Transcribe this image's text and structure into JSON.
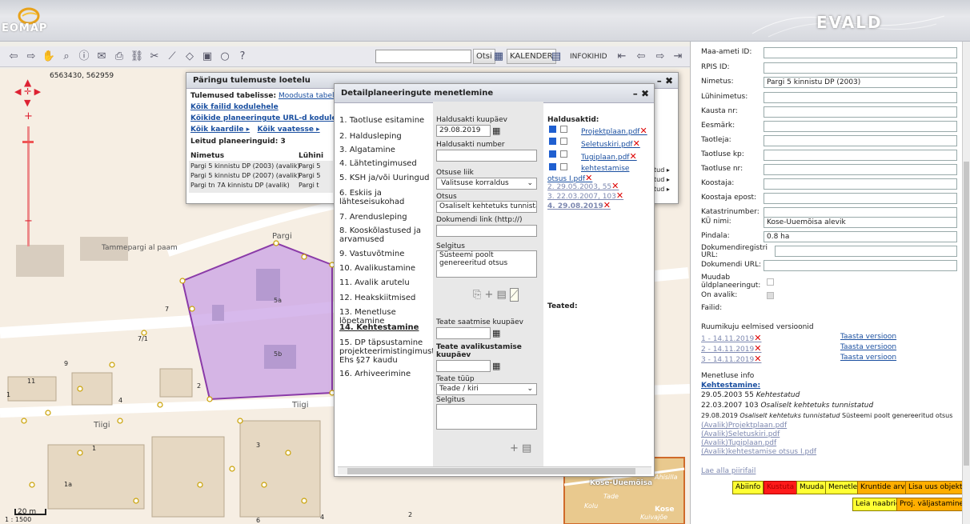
{
  "header": {
    "logo_text": "EOMAP",
    "brand": "EVALD"
  },
  "toolbar": {
    "search_button": "Otsi",
    "calendar_label": "KALENDER",
    "info_label": "INFOKIHID"
  },
  "map": {
    "coords": "6563430, 562959",
    "scale_bar": "20 m",
    "scale": "1 : 1500",
    "labels": {
      "tamme": "Tammepargi al paam",
      "pargi": "Pargi",
      "tiigi1": "Tiigi",
      "tiigi2": "Tiigi",
      "kose": "Kose-Uuemõisa",
      "tade": "Tade",
      "kolu": "Kolu",
      "kose2": "Kose",
      "ahisilla": "Ahisilla",
      "kuivajoe": "Kuivajõe"
    },
    "parcels": [
      "5a",
      "5b",
      "7",
      "7/1",
      "9",
      "11",
      "1",
      "4",
      "2",
      "1a",
      "3",
      "1",
      "2",
      "6",
      "4"
    ]
  },
  "results_window": {
    "title": "Päringu tulemuste loetelu",
    "tabular_label": "Tulemused tabelisse:",
    "tabular_link": "Moodusta tabel/välj",
    "links": [
      "Kõik failid kodulehele",
      "Kõikide planeeringute URL-d kodulehele"
    ],
    "all_map": "Kõik kaardile ▸",
    "all_view": "Kõik vaatesse ▸",
    "found": "Leitud planeeringuid: 3",
    "col_name": "Nimetus",
    "col_short": "Lühini",
    "rows": [
      {
        "name": "Pargi 5 kinnistu DP (2003) (avalik)",
        "short": "Pargi 5",
        "tail": "tud ▸"
      },
      {
        "name": "Pargi 5 kinnistu DP (2007) (avalik)",
        "short": "Pargi 5",
        "tail": "tud ▸"
      },
      {
        "name": "Pargi tn 7A kinnistu DP (avalik)",
        "short": "Pargi t",
        "tail": "tud ▸"
      }
    ]
  },
  "proc_window": {
    "title": "Detailplaneeringute menetlemine",
    "steps": [
      "1. Taotluse esitamine",
      "2. Haldusleping",
      "3. Algatamine",
      "4. Lähtetingimused",
      "5. KSH ja/või Uuringud",
      "6. Eskiis ja lähteseisukohad",
      "7. Arendusleping",
      "8. Kooskõlastused ja arvamused",
      "9. Vastuvõtmine",
      "10. Avalikustamine",
      "11. Avalik arutelu",
      "12. Heakskiitmised",
      "13. Menetluse lõpetamine",
      "14. Kehtestamine",
      "15. DP täpsustamine projekteerimistingimuste Ehs §27 kaudu",
      "16. Arhiveerimine"
    ],
    "haldusakti_kp_label": "Haldusakti kuupäev",
    "haldusakti_kp": "29.08.2019",
    "haldusakti_nr_label": "Haldusakti number",
    "haldusakti_nr": "",
    "otsuse_liik_label": "Otsuse liik",
    "otsuse_liik": "Valitsuse korraldus",
    "otsus_label": "Otsus",
    "otsus": "Osaliselt kehtetuks tunnista",
    "dok_link_label": "Dokumendi link (http://)",
    "dok_link": "",
    "selgitus_label": "Selgitus",
    "selgitus": "Süsteemi poolt genereeritud otsus",
    "haldusaktid_label": "Haldusaktid:",
    "files": [
      "Projektplaan.pdf",
      "Seletuskiri.pdf",
      "Tugiplaan.pdf",
      "kehtestamise otsus I.pdf"
    ],
    "acts": [
      "2. 29.05.2003, 55",
      "3. 22.03.2007, 103",
      "4. 29.08.2019"
    ],
    "teated_label": "Teated:",
    "teate_saatmise_label": "Teate saatmise kuupäev",
    "teate_avalik_label": "Teate avalikustamise kuupäev",
    "teate_tyyp_label": "Teate tüüp",
    "teate_tyyp": "Teade / kiri",
    "selgitus2_label": "Selgitus"
  },
  "right_panel": {
    "fields": [
      {
        "label": "Maa-ameti ID:",
        "value": ""
      },
      {
        "label": "RPIS ID:",
        "value": ""
      },
      {
        "label": "Nimetus:",
        "value": "Pargi 5 kinnistu DP (2003)"
      },
      {
        "label": "Lühinimetus:",
        "value": ""
      },
      {
        "label": "Kausta nr:",
        "value": ""
      },
      {
        "label": "Eesmärk:",
        "value": ""
      },
      {
        "label": "Taotleja:",
        "value": ""
      },
      {
        "label": "Taotluse kp:",
        "value": ""
      },
      {
        "label": "Taotluse nr:",
        "value": ""
      },
      {
        "label": "Koostaja:",
        "value": ""
      },
      {
        "label": "Koostaja epost:",
        "value": ""
      },
      {
        "label": "Katastrinumber:",
        "value": ""
      },
      {
        "label": "KÜ nimi:",
        "value": "Kose-Uuemõisa alevik"
      },
      {
        "label": "Pindala:",
        "value": "0.8 ha"
      }
    ],
    "dok_reg_label": "Dokumendiregistri URL:",
    "dok_url_label": "Dokumendi URL:",
    "muudab_label": "Muudab üldplaneeringut:",
    "on_avalik_label": "On avalik:",
    "failid_label": "Failid:",
    "versions_label": "Ruumikuju eelmised versioonid",
    "versions": [
      "1 - 14.11.2019",
      "2 - 14.11.2019",
      "3 - 14.11.2019"
    ],
    "restore": "Taasta versioon",
    "menetluse_info": "Menetluse info",
    "kehtestamine": "Kehtestamine:",
    "history": [
      {
        "a": "29.05.2003 55 ",
        "b": "Kehtestatud",
        "c": ""
      },
      {
        "a": "22.03.2007 103 ",
        "b": "Osaliselt kehtetuks tunnistatud",
        "c": ""
      },
      {
        "a": "29.08.2019 ",
        "b": "Osaliselt kehtetuks tunnistatud",
        "c": " Süsteemi poolt genereeritud otsus"
      }
    ],
    "pub_files": [
      "(Avalik)Projektplaan.pdf",
      "(Avalik)Seletuskiri.pdf",
      "(Avalik)Tugiplaan.pdf",
      "(Avalik)kehtestamise otsus I.pdf"
    ],
    "lae_alla": "Lae alla piirifail",
    "buttons": [
      "Abiinfo",
      "Kustuta",
      "Muuda",
      "Menetle",
      "Kruntide arv",
      "Lisa uus objekt",
      "Leia naabrid",
      "Proj. väljastamine"
    ]
  }
}
